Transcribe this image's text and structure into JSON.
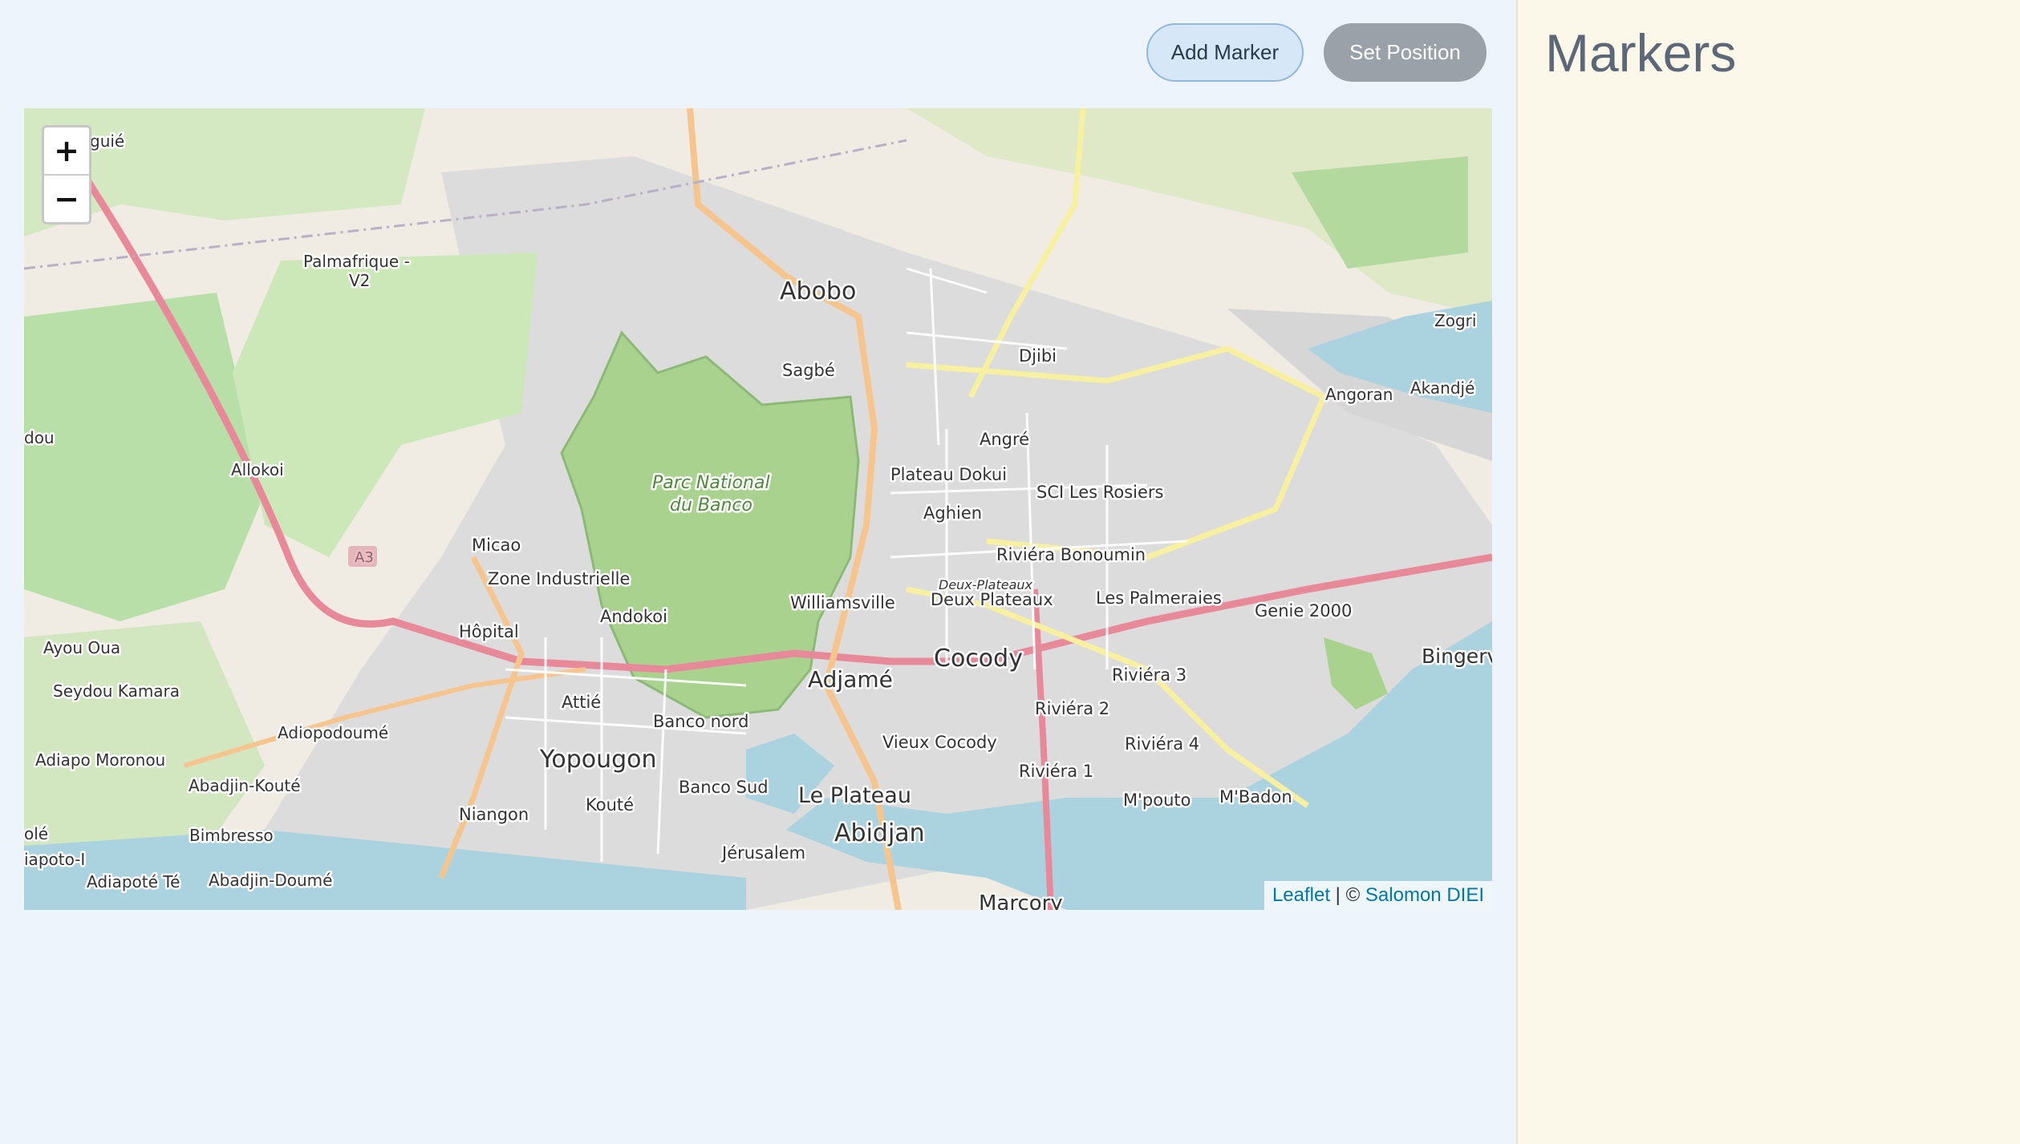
{
  "toolbar": {
    "add_marker_label": "Add Marker",
    "set_position_label": "Set Position"
  },
  "map": {
    "zoom_in": "+",
    "zoom_out": "−",
    "attribution": {
      "leaflet": "Leaflet",
      "separator": " | © ",
      "author": "Salomon DIEI"
    },
    "place_labels": {
      "abobo": "Abobo",
      "sagbe": "Sagbé",
      "djibi": "Djibi",
      "zogri": "Zogri",
      "angoran": "Angoran",
      "akandje": "Akandjé",
      "palmafrique": "Palmafrique -",
      "v2": "V2",
      "dou": "dou",
      "allokoi": "Allokoi",
      "park1": "Parc National",
      "park2": "du Banco",
      "angre": "Angré",
      "plateau_dokui": "Plateau Dokui",
      "sci": "SCI Les Rosiers",
      "aghien": "Aghien",
      "micao": "Micao",
      "a3": "A3",
      "zone_ind": "Zone Industrielle",
      "riv_bonoumin": "Riviéra Bonoumin",
      "deux_plat_small": "Deux-Plateaux",
      "williamsville": "Williamsville",
      "deux_plateaux": "Deux Plateaux",
      "palmeraies": "Les Palmeraies",
      "genie": "Genie 2000",
      "andokoi": "Andokoi",
      "hopital": "Hôpital",
      "ayou": "Ayou Oua",
      "cocody": "Cocody",
      "bingerv": "Bingerv",
      "adjame": "Adjamé",
      "riv3": "Riviéra 3",
      "seydou": "Seydou Kamara",
      "attie": "Attié",
      "riv2": "Riviéra 2",
      "banco_nord": "Banco nord",
      "adiopodoume": "Adiopodoumé",
      "vieux_cocody": "Vieux Cocody",
      "riv4": "Riviéra 4",
      "adiapo": "Adiapo Moronou",
      "yopougon": "Yopougon",
      "riv1": "Riviéra 1",
      "abadjin_koute": "Abadjin-Kouté",
      "banco_sud": "Banco Sud",
      "le_plateau": "Le Plateau",
      "mbadon": "M'Badon",
      "mpouto": "M'pouto",
      "koute": "Kouté",
      "niangon": "Niangon",
      "abidjan": "Abidjan",
      "bimbresso": "Bimbresso",
      "ole": "olé",
      "jerusalem": "Jérusalem",
      "iapoto": "iapoto-I",
      "adiapote": "Adiapoté Té",
      "abadjin_doume": "Abadjin-Doumé",
      "marcory": "Marcory",
      "guie": "guié"
    }
  },
  "sidebar": {
    "title": "Markers"
  }
}
